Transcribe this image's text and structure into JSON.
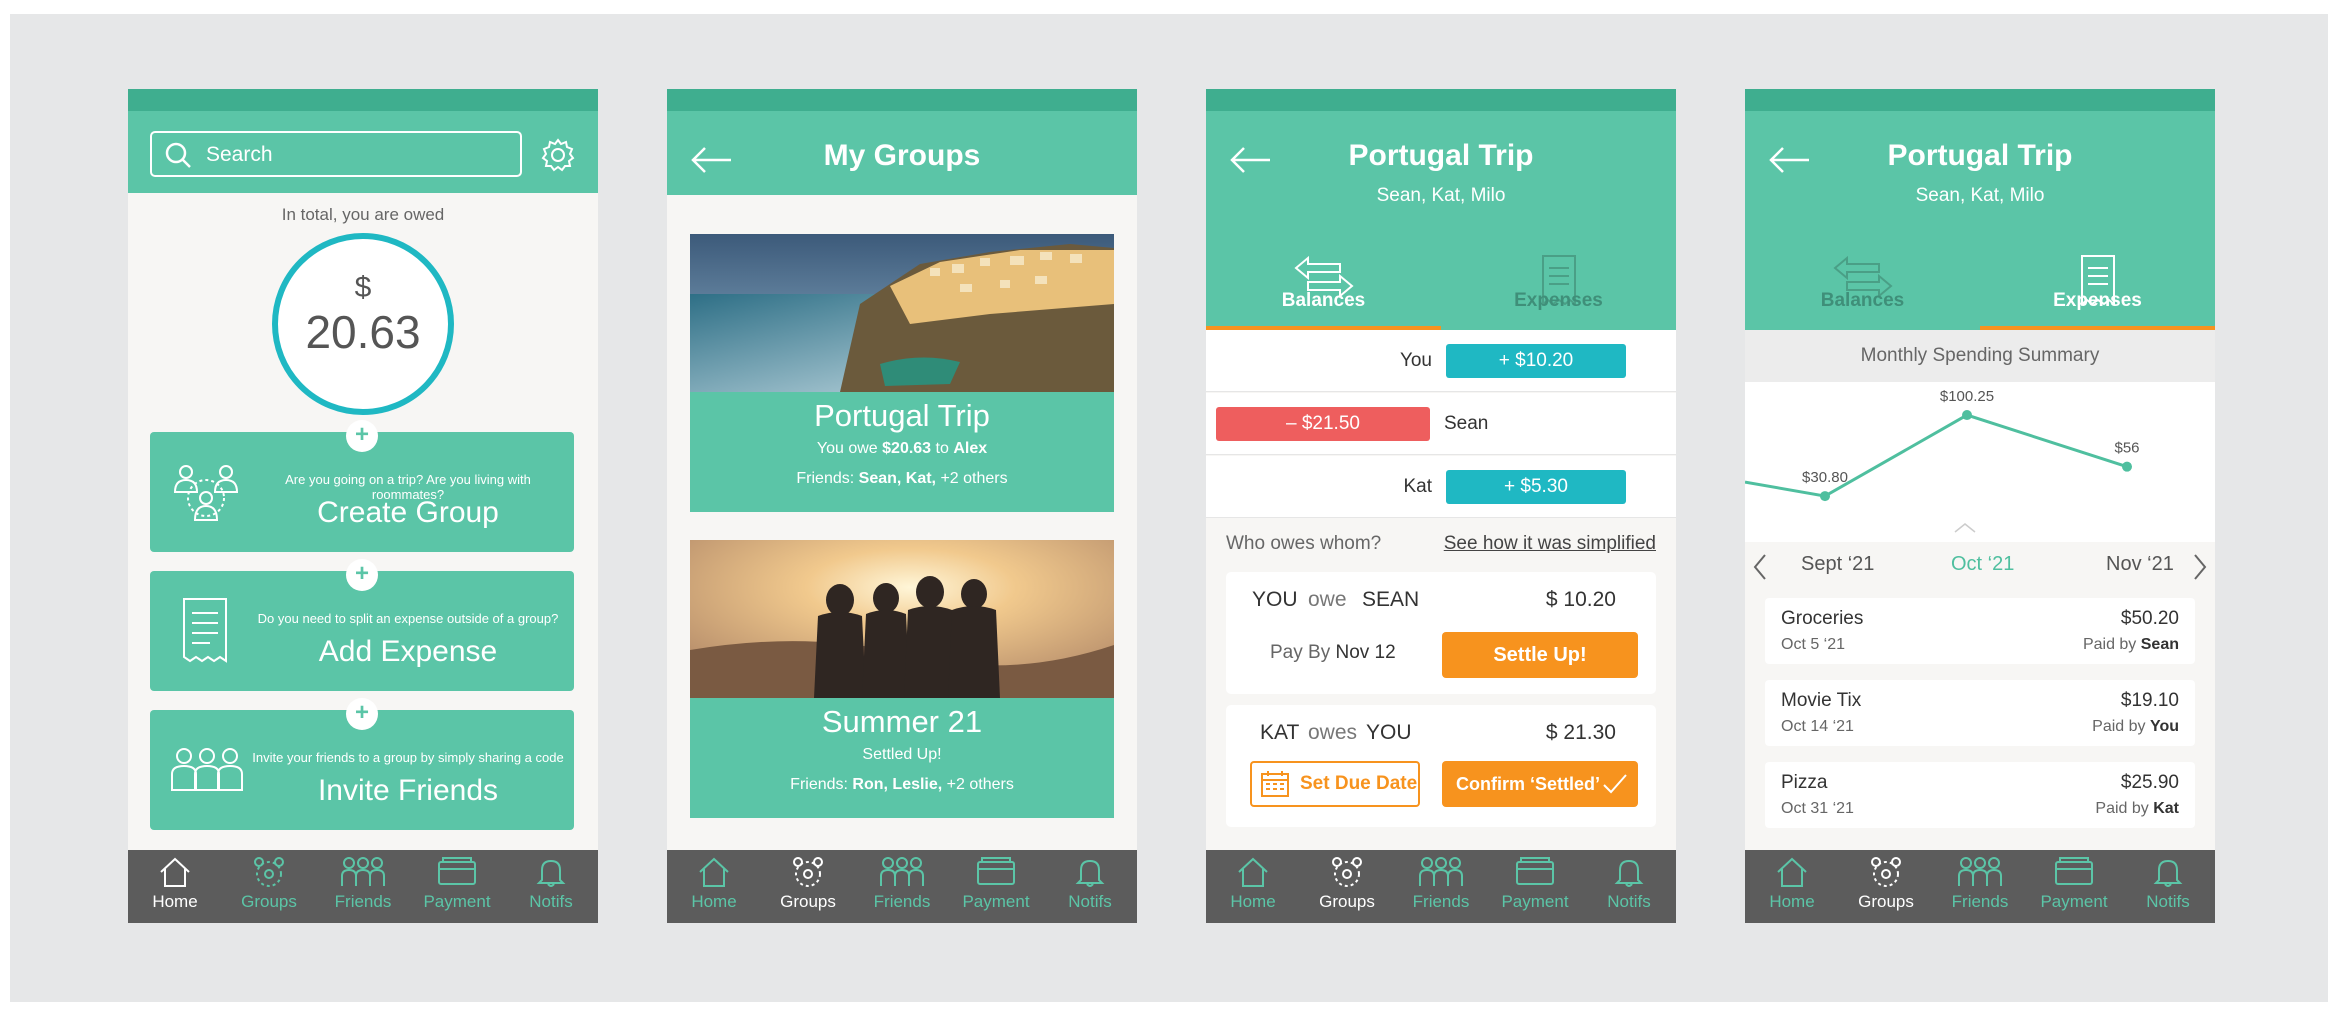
{
  "tabbar": {
    "home": "Home",
    "groups": "Groups",
    "friends": "Friends",
    "payment": "Payment",
    "notifs": "Notifs"
  },
  "home": {
    "search_placeholder": "Search",
    "owed_label": "In total, you are owed",
    "currency": "$",
    "owed_amount": "20.63",
    "cards": [
      {
        "question": "Are you going on a trip? Are you living with roommates?",
        "title": "Create Group"
      },
      {
        "question": "Do you need to split an expense outside of a group?",
        "title": "Add Expense"
      },
      {
        "question": "Invite your friends to a group by simply sharing a code",
        "title": "Invite Friends"
      }
    ]
  },
  "groups": {
    "title": "My Groups",
    "items": [
      {
        "name": "Portugal Trip",
        "owe_prefix": "You owe ",
        "owe_amount": "$20.63",
        "owe_to": " to ",
        "owe_person": "Alex",
        "friends_label": "Friends: ",
        "friends": "Sean, Kat,",
        "others": " +2 others"
      },
      {
        "name": "Summer 21",
        "status": "Settled Up!",
        "friends_label": "Friends: ",
        "friends": "Ron, Leslie,",
        "others": " +2 others"
      }
    ]
  },
  "trip": {
    "title": "Portugal Trip",
    "members": "Sean, Kat, Milo",
    "tab_balances": "Balances",
    "tab_expenses": "Expenses",
    "balances": [
      {
        "name": "You",
        "amount": "+ $10.20"
      },
      {
        "name": "Sean",
        "amount": "–  $21.50"
      },
      {
        "name": "Kat",
        "amount": "+ $5.30"
      }
    ],
    "who_owes": "Who owes whom?",
    "simplified_link": "See how it was simplified",
    "debt1": {
      "from": "YOU",
      "verb": "owe",
      "to": "SEAN",
      "amount": "$ 10.20",
      "pay_by": "Pay By ",
      "date": "Nov 12",
      "button": "Settle Up!"
    },
    "debt2": {
      "from": "KAT",
      "verb": "owes",
      "to": "YOU",
      "amount": "$ 21.30",
      "due_button": "Set Due Date",
      "confirm_button": "Confirm ‘Settled’"
    }
  },
  "expenses": {
    "summary_title": "Monthly Spending Summary",
    "months": {
      "prev": "Sept ‘21",
      "current": "Oct ‘21",
      "next": "Nov ‘21"
    },
    "items": [
      {
        "name": "Groceries",
        "date": "Oct 5 ‘21",
        "amount": "$50.20",
        "paid_prefix": "Paid by ",
        "payer": "Sean"
      },
      {
        "name": "Movie Tix",
        "date": "Oct 14 ‘21",
        "amount": "$19.10",
        "paid_prefix": "Paid by ",
        "payer": "You"
      },
      {
        "name": "Pizza",
        "date": "Oct 31 ‘21",
        "amount": "$25.90",
        "paid_prefix": "Paid by ",
        "payer": "Kat"
      }
    ]
  },
  "chart_data": {
    "type": "line",
    "title": "Monthly Spending Summary",
    "categories": [
      "Sept ‘21",
      "Oct ‘21",
      "Nov ‘21"
    ],
    "values": [
      30.8,
      100.25,
      56
    ],
    "labels": [
      "$30.80",
      "$100.25",
      "$56"
    ],
    "ylim": [
      0,
      120
    ],
    "grid": false
  },
  "colors": {
    "primary": "#5bc5a7",
    "primary_dark": "#3fae8f",
    "accent": "#f7931e",
    "positive": "#1fb8c3",
    "negative": "#ee5e5e",
    "tabbar": "#5c5c5c"
  }
}
